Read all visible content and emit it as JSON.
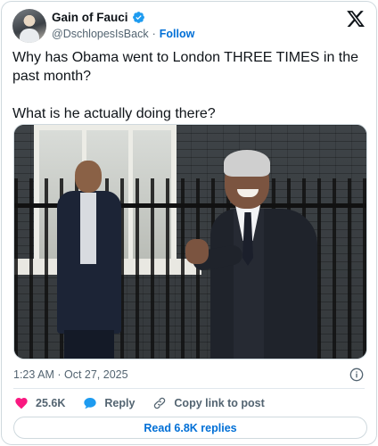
{
  "author": {
    "display_name": "Gain of Fauci",
    "handle": "@DschlopesIsBack",
    "follow_label": "Follow",
    "separator": "·",
    "verified_icon": "verified-badge-icon",
    "avatar_icon": "avatar"
  },
  "brand": {
    "logo": "x-logo-icon"
  },
  "tweet": {
    "paragraphs": [
      "Why has Obama went to London THREE TIMES in the past month?",
      "What is he actually doing there?"
    ]
  },
  "media": {
    "kind": "photo"
  },
  "meta": {
    "timestamp": "1:23 AM · Oct 27, 2025"
  },
  "actions": {
    "like_count": "25.6K",
    "reply_label": "Reply",
    "copy_link_label": "Copy link to post"
  },
  "replies_button": {
    "label": "Read 6.8K replies"
  },
  "colors": {
    "accent": "#006fd6",
    "verified": "#1d9bf0",
    "like": "#f91880",
    "reply": "#1d9bf0",
    "text": "#0f1419",
    "muted": "#536471",
    "border": "#cfd9de"
  }
}
